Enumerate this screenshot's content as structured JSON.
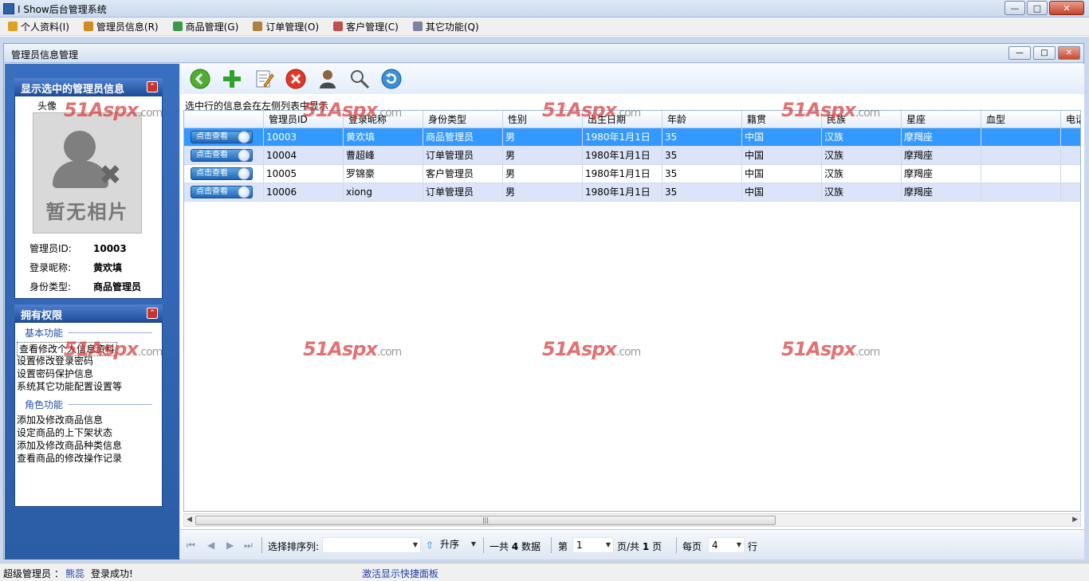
{
  "window": {
    "title": "I Show后台管理系统"
  },
  "menu": [
    {
      "label": "个人资料(I)",
      "color": "#e0a020"
    },
    {
      "label": "管理员信息(R)",
      "color": "#d08a20"
    },
    {
      "label": "商品管理(G)",
      "color": "#3a9a4a"
    },
    {
      "label": "订单管理(O)",
      "color": "#b08040"
    },
    {
      "label": "客户管理(C)",
      "color": "#c05050"
    },
    {
      "label": "其它功能(Q)",
      "color": "#8080a0"
    }
  ],
  "child_window": {
    "title": "管理员信息管理"
  },
  "selected_panel": {
    "header": "显示选中的管理员信息",
    "avatar_label": "头像",
    "no_photo": "暂无相片",
    "fields": [
      {
        "label": "管理员ID:",
        "value": "10003"
      },
      {
        "label": "登录昵称:",
        "value": "黄欢填"
      },
      {
        "label": "身份类型:",
        "value": "商品管理员"
      }
    ]
  },
  "permissions_panel": {
    "header": "拥有权限",
    "basic_title": "基本功能",
    "basic_items": [
      "查看修改个人信息资料",
      "设置修改登录密码",
      "设置密码保护信息",
      "系统其它功能配置设置等"
    ],
    "role_title": "角色功能",
    "role_items": [
      "添加及修改商品信息",
      "设定商品的上下架状态",
      "添加及修改商品种类信息",
      "查看商品的修改操作记录"
    ]
  },
  "toolbar": [
    {
      "name": "back-icon"
    },
    {
      "name": "add-icon"
    },
    {
      "name": "edit-icon"
    },
    {
      "name": "delete-icon"
    },
    {
      "name": "user-icon"
    },
    {
      "name": "search-icon"
    },
    {
      "name": "refresh-icon"
    }
  ],
  "hint": "选中行的信息会在左侧列表中显示",
  "grid": {
    "columns": [
      "",
      "管理员ID",
      "登录昵称",
      "身份类型",
      "性别",
      "出生日期",
      "年龄",
      "籍贯",
      "民族",
      "星座",
      "血型",
      "电话"
    ],
    "view_button": "点击查看",
    "rows": [
      [
        "10003",
        "黄欢填",
        "商品管理员",
        "男",
        "1980年1月1日",
        "35",
        "中国",
        "汉族",
        "摩羯座",
        "",
        ""
      ],
      [
        "10004",
        "曹超峰",
        "订单管理员",
        "男",
        "1980年1月1日",
        "35",
        "中国",
        "汉族",
        "摩羯座",
        "",
        ""
      ],
      [
        "10005",
        "罗锦豪",
        "客户管理员",
        "男",
        "1980年1月1日",
        "35",
        "中国",
        "汉族",
        "摩羯座",
        "",
        ""
      ],
      [
        "10006",
        "xiong",
        "订单管理员",
        "男",
        "1980年1月1日",
        "35",
        "中国",
        "汉族",
        "摩羯座",
        "",
        ""
      ]
    ]
  },
  "navbar": {
    "sort_label": "选择排序列:",
    "sort_value": "",
    "order_label": "升序",
    "total_prefix": "一共",
    "total_count": "4",
    "total_suffix": "数据",
    "page_prefix": "第",
    "page_value": "1",
    "page_mid": "页/共",
    "page_total": "1",
    "page_suffix": "页",
    "per_page_prefix": "每页",
    "per_page_value": "4",
    "per_page_suffix": "行"
  },
  "status": {
    "role": "超级管理员 ：",
    "user": "熊蕊",
    "message": "登录成功!",
    "shortcut": "激活显示快捷面板"
  },
  "watermark": {
    "brand": "51Aspx",
    "suffix": ".com"
  },
  "colors": {
    "selected_row": "#3399ff",
    "alt_row": "#dbe4f8",
    "panel_blue": "#2b5ca6"
  }
}
